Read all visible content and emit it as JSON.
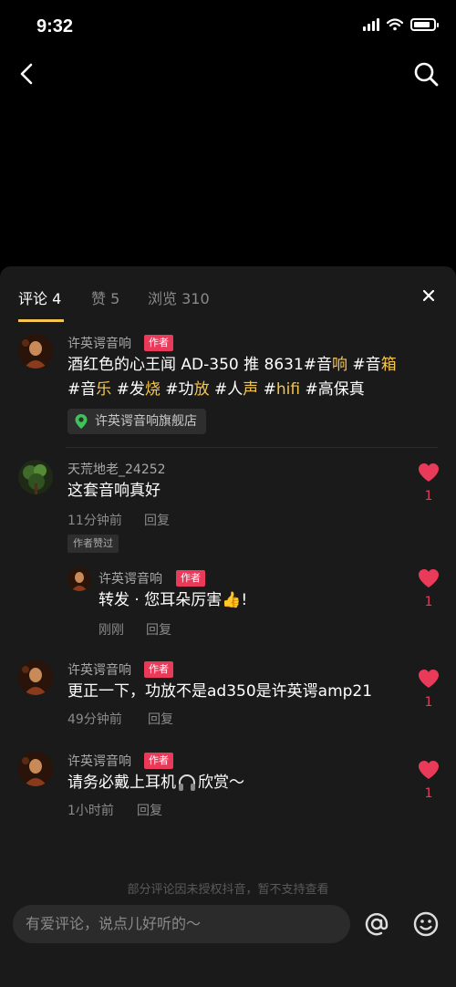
{
  "status_bar": {
    "time": "9:32"
  },
  "tabs": [
    {
      "label": "评论 4",
      "active": true
    },
    {
      "label": "赞 5",
      "active": false
    },
    {
      "label": "浏览 310",
      "active": false
    }
  ],
  "author_badge": "作者",
  "reply_label": "回复",
  "comments": [
    {
      "username": "许英谔音响",
      "is_author": true,
      "text_line1_parts": [
        "酒红色的心王闻 AD-350 推 8631#音",
        "响",
        " #音",
        "箱"
      ],
      "text_line2_parts": [
        "#音",
        "乐",
        " #发",
        "烧",
        " #功",
        "放",
        " #人",
        "声",
        " #",
        "hifi",
        " #高保真"
      ],
      "shop_tag": "许英谔音响旗舰店"
    },
    {
      "username": "天荒地老_24252",
      "is_author": false,
      "text": "这套音响真好",
      "time": "11分钟前",
      "liked_tag": "作者赞过",
      "likes": "1",
      "reply": {
        "username": "许英谔音响",
        "text": "转发 · 您耳朵厉害",
        "emoji": "👍",
        "text_end": "!",
        "time": "刚刚",
        "likes": "1"
      }
    },
    {
      "username": "许英谔音响",
      "is_author": true,
      "text": "更正一下，功放不是ad350是许英谔amp21",
      "time": "49分钟前",
      "likes": "1"
    },
    {
      "username": "许英谔音响",
      "is_author": true,
      "text_before": "请务必戴上耳机",
      "text_after": "欣赏～",
      "time": "1小时前",
      "likes": "1"
    }
  ],
  "footer_note": "部分评论因未授权抖音，暂不支持查看",
  "input": {
    "placeholder": "有爱评论，说点儿好听的～"
  },
  "colors": {
    "accent": "#f5c64d",
    "like": "#ea3a5a",
    "badge": "#ea3a5a"
  },
  "icons": [
    "back-icon",
    "search-icon",
    "close-icon",
    "location-pin-icon",
    "heart-icon",
    "headphone-icon",
    "at-icon",
    "emoji-icon"
  ]
}
